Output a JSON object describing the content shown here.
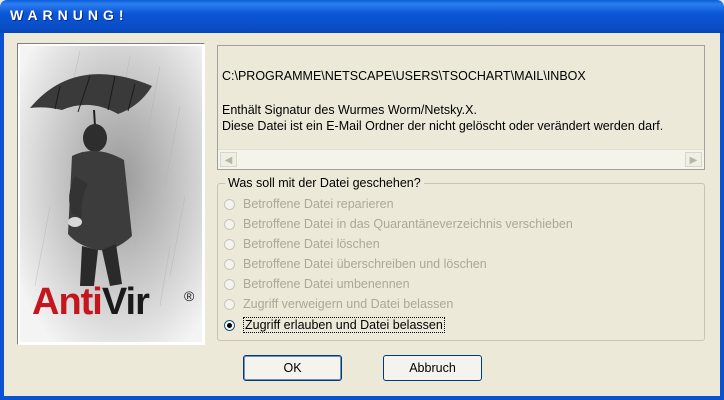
{
  "window": {
    "title": "WARNUNG!"
  },
  "logo": {
    "brand_anti": "Anti",
    "brand_vir": "Vir",
    "registered": "®"
  },
  "message": {
    "path": "C:\\PROGRAMME\\NETSCAPE\\USERS\\TSOCHART\\MAIL\\INBOX",
    "line1": "Enthält Signatur des Wurmes Worm/Netsky.X.",
    "line2": "Diese Datei ist ein E-Mail Ordner der nicht gelöscht oder verändert werden darf."
  },
  "group": {
    "legend": "Was soll mit der Datei geschehen?",
    "options": [
      {
        "label": "Betroffene Datei reparieren",
        "enabled": false,
        "selected": false
      },
      {
        "label": "Betroffene Datei in das Quarantäneverzeichnis verschieben",
        "enabled": false,
        "selected": false
      },
      {
        "label": "Betroffene Datei löschen",
        "enabled": false,
        "selected": false
      },
      {
        "label": "Betroffene Datei überschreiben und löschen",
        "enabled": false,
        "selected": false
      },
      {
        "label": "Betroffene Datei umbenennen",
        "enabled": false,
        "selected": false
      },
      {
        "label": "Zugriff verweigern und Datei belassen",
        "enabled": false,
        "selected": false
      },
      {
        "label": "Zugriff erlauben und Datei belassen",
        "enabled": true,
        "selected": true
      }
    ]
  },
  "buttons": {
    "ok": "OK",
    "cancel": "Abbruch"
  }
}
